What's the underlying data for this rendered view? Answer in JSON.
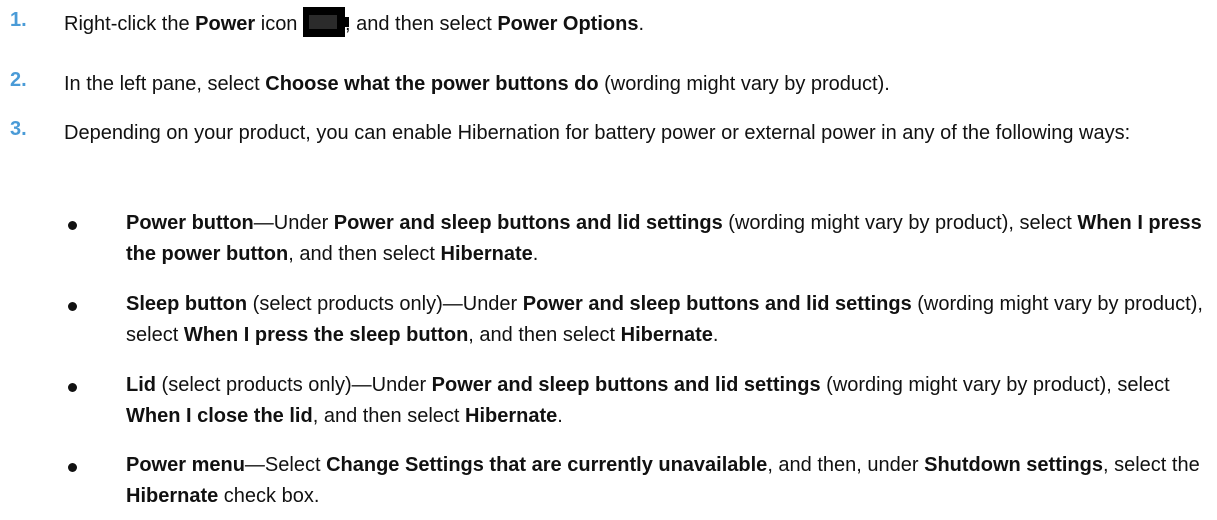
{
  "steps": [
    {
      "number": "1.",
      "parts": [
        "Right-click the ",
        "Power",
        " icon ",
        ", and then select ",
        "Power Options",
        "."
      ]
    },
    {
      "number": "2.",
      "parts": [
        "In the left pane, select ",
        "Choose what the power buttons do",
        " (wording might vary by product)."
      ]
    },
    {
      "number": "3.",
      "parts": [
        "Depending on your product, you can enable Hibernation for battery power or external power in any of the following ways:"
      ]
    }
  ],
  "bullets": [
    {
      "parts": [
        "Power button",
        "—Under ",
        "Power and sleep buttons and lid settings",
        " (wording might vary by product), select ",
        "When I press the power button",
        ", and then select ",
        "Hibernate",
        "."
      ]
    },
    {
      "parts": [
        "Sleep button",
        " (select products only)—Under ",
        "Power and sleep buttons and lid settings",
        " (wording might vary by product), select ",
        "When I press the sleep button",
        ", and then select ",
        "Hibernate",
        "."
      ]
    },
    {
      "parts": [
        "Lid",
        " (select products only)—Under ",
        "Power and sleep buttons and lid settings",
        " (wording might vary by product), select ",
        "When I close the lid",
        ", and then select ",
        "Hibernate",
        "."
      ]
    },
    {
      "parts": [
        "Power menu",
        "—Select ",
        "Change Settings that are currently unavailable",
        ", and then, under ",
        "Shutdown settings",
        ", select the ",
        "Hibernate",
        " check box."
      ]
    }
  ],
  "icons": {
    "power_icon": "battery-icon"
  },
  "colors": {
    "step_number": "#4a9bd7",
    "text": "#111111"
  }
}
